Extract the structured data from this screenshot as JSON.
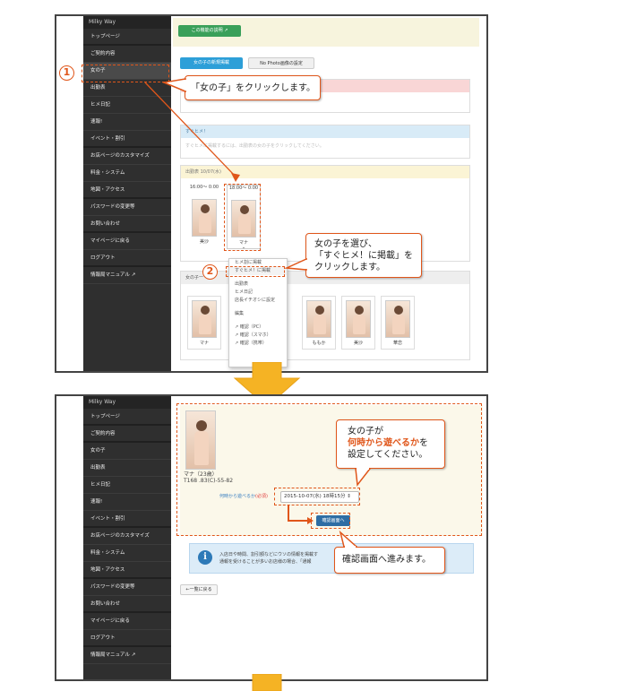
{
  "sidebar": {
    "brand": "Milky Way",
    "items": [
      "トップページ",
      "ご契約内容",
      "女の子",
      "出勤表",
      "ヒメ日記",
      "速報!",
      "イベント・割引",
      "お店ページのカスタマイズ",
      "料金・システム",
      "地図・アクセス",
      "パスワードの変更等",
      "お問い合わせ",
      "マイページに戻る",
      "ログアウト",
      "情報局マニュアル"
    ]
  },
  "shot1": {
    "explain_button": "この機能の説明",
    "tab_new_post": "女の子の新規掲載",
    "tab_nophoto": "No Photo画像の設定",
    "sugu_panel_title": "すぐヒメ！",
    "sugu_panel_hint": "すぐヒメに掲載するには、出勤表の女の子をクリックしてください。",
    "schedule_title": "出勤表 10/07(水)",
    "cards": [
      {
        "time": "16:00～ 0:00",
        "name": "美沙"
      },
      {
        "time": "18:00～ 0:00",
        "name": "マナ"
      }
    ],
    "girls_panel_title": "女の子一",
    "girls": [
      "マナ",
      "",
      "",
      "ももか",
      "美沙",
      "華恋"
    ],
    "dropdown": [
      "ヒメ割に掲載",
      "すぐヒメ！に掲載",
      "出勤表",
      "ヒメ日記",
      "店長イチオシに設定",
      "編集",
      "確認（PC）",
      "確認（スマホ）",
      "確認（携帯）"
    ]
  },
  "shot2": {
    "girl_name": "マナ（23歳）",
    "girl_size": "T168 .83(C)-55-82",
    "when_label": "何時から遊べるか",
    "required": "(必須)",
    "select_value": "2015-10-07(水) 18時15分",
    "confirm_button": "確認画面へ",
    "info_text_1": "入店日や時間、割引額などにウソの情報を掲載す",
    "info_text_2": "通報を受けることが多いお店様の場合、「通報",
    "back_button": "←一覧に戻る"
  },
  "callouts": {
    "c1": "「女の子」をクリックします。",
    "c2_lines": [
      "女の子を選び、",
      "「すぐヒメ！に掲載」を",
      "クリックします。"
    ],
    "c3_line1": "女の子が",
    "c3_highlight": "何時から遊べるか",
    "c3_suffix": "を",
    "c3_line3": "設定してください。",
    "c4": "確認画面へ進みます。",
    "num1": "1",
    "num2": "2"
  },
  "colors": {
    "accent": "#e0561a",
    "sidebar": "#2f2f2f",
    "arrow": "#f5b324"
  }
}
